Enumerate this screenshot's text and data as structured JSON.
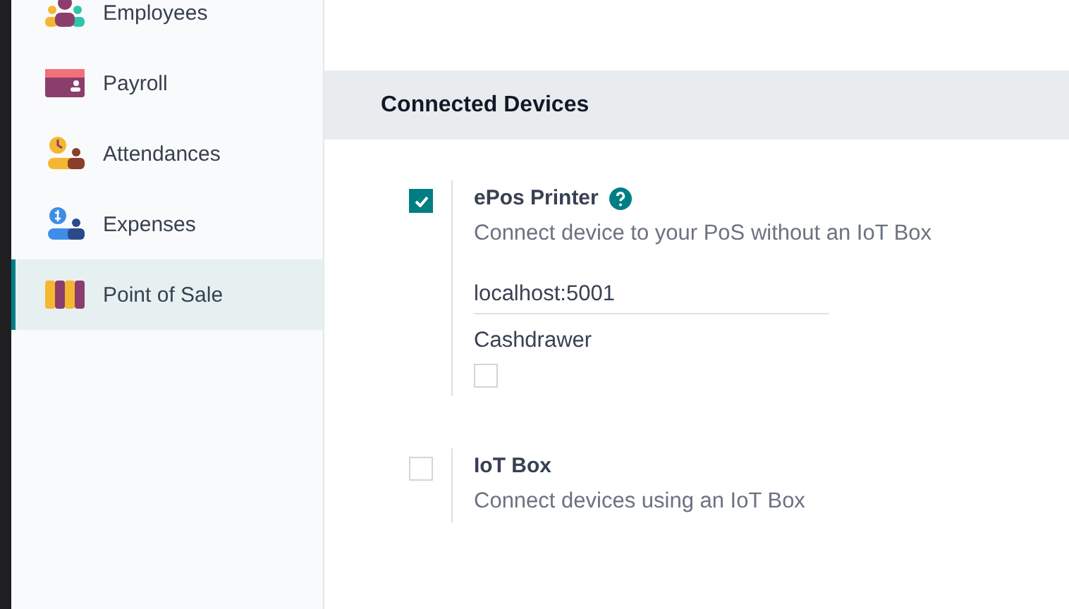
{
  "sidebar": {
    "items": [
      {
        "label": "Employees",
        "selected": false
      },
      {
        "label": "Payroll",
        "selected": false
      },
      {
        "label": "Attendances",
        "selected": false
      },
      {
        "label": "Expenses",
        "selected": false
      },
      {
        "label": "Point of Sale",
        "selected": true
      }
    ]
  },
  "section": {
    "title": "Connected Devices"
  },
  "settings": [
    {
      "label": "ePos Printer",
      "help": true,
      "checked": true,
      "description": "Connect device to your PoS without an IoT Box",
      "fields": [
        {
          "kind": "input",
          "value": "localhost:5001"
        },
        {
          "kind": "checkbox",
          "label": "Cashdrawer",
          "checked": false
        }
      ]
    },
    {
      "label": "IoT Box",
      "help": false,
      "checked": false,
      "description": "Connect devices using an IoT Box"
    }
  ]
}
